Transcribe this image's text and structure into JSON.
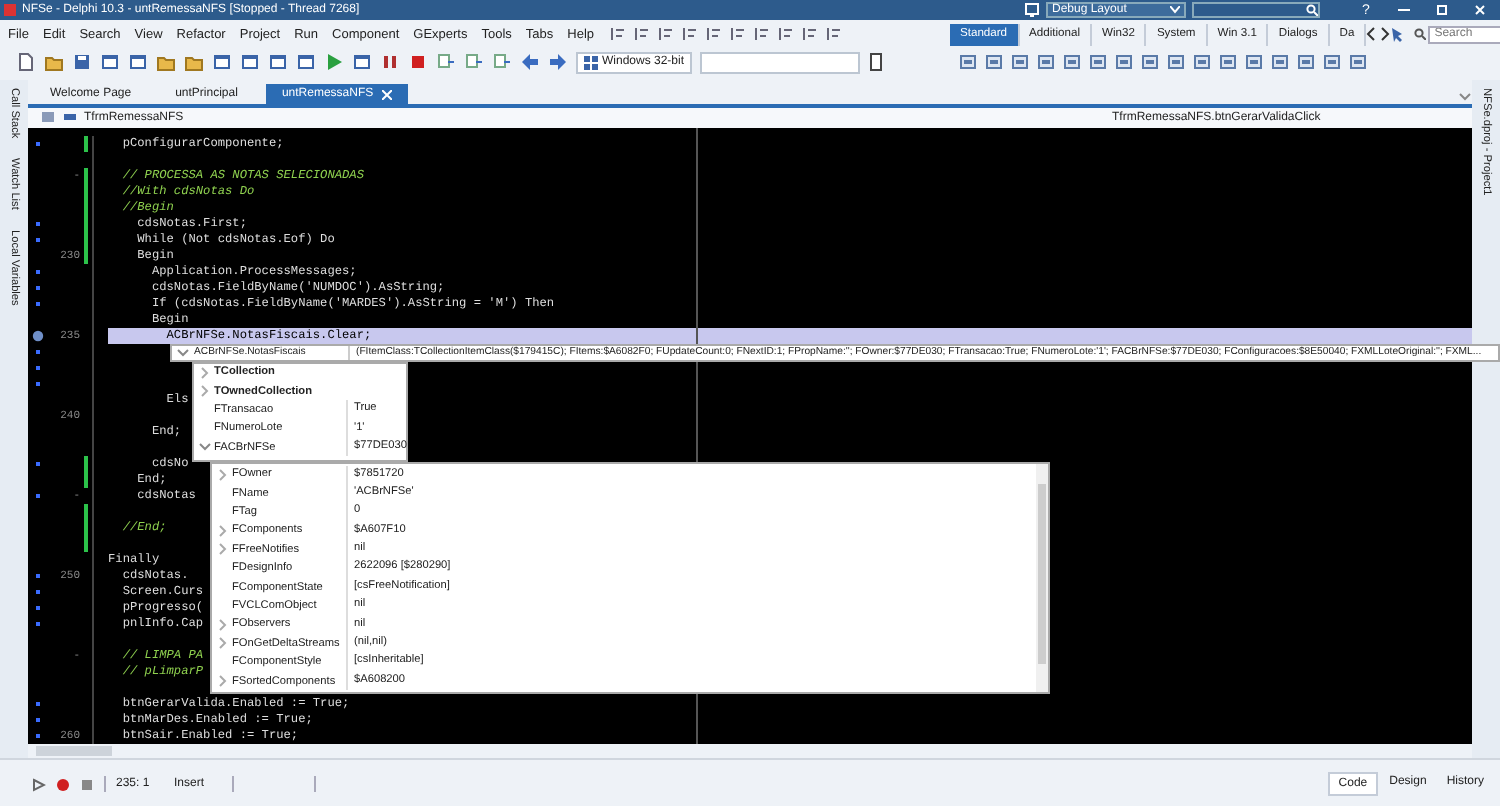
{
  "window": {
    "title": "NFSe - Delphi 10.3 - untRemessaNFS [Stopped - Thread 7268]",
    "layout": "Debug Layout",
    "help": "?"
  },
  "menu": [
    "File",
    "Edit",
    "Search",
    "View",
    "Refactor",
    "Project",
    "Run",
    "Component",
    "GExperts",
    "Tools",
    "Tabs",
    "Help"
  ],
  "toolbar": {
    "platform": "Windows 32-bit"
  },
  "palette": {
    "tabs": [
      {
        "label": "Standard",
        "selected": true
      },
      {
        "label": "Additional",
        "selected": false
      },
      {
        "label": "Win32",
        "selected": false
      },
      {
        "label": "System",
        "selected": false
      },
      {
        "label": "Win 3.1",
        "selected": false
      },
      {
        "label": "Dialogs",
        "selected": false
      },
      {
        "label": "Da",
        "selected": false
      }
    ],
    "search_placeholder": "Search"
  },
  "side_panels": [
    "Call Stack",
    "Watch List",
    "Local Variables"
  ],
  "right_panel": "NFSe.dproj - Project1",
  "editor_tabs": [
    {
      "label": "Welcome Page",
      "selected": false
    },
    {
      "label": "untPrincipal",
      "selected": false
    },
    {
      "label": "untRemessaNFS",
      "selected": true
    }
  ],
  "class_selector": "TfrmRemessaNFS",
  "method_selector": "TfrmRemessaNFS.btnGerarValidaClick",
  "lines": [
    {
      "dot": true,
      "changed": true,
      "current": false,
      "kind": "code",
      "text": "  pConfigurarComponente;"
    },
    {
      "dot": false,
      "changed": false,
      "current": false
    },
    {
      "number": "-",
      "dot": false,
      "changed": true,
      "current": false,
      "kind": "comment",
      "text": "  // PROCESSA AS NOTAS SELECIONADAS"
    },
    {
      "dot": false,
      "changed": true,
      "current": false,
      "kind": "comment",
      "text": "  //With cdsNotas Do"
    },
    {
      "dot": false,
      "changed": true,
      "current": false,
      "kind": "comment",
      "text": "  //Begin"
    },
    {
      "dot": true,
      "changed": true,
      "current": false,
      "kind": "code",
      "text": "    cdsNotas.First;"
    },
    {
      "dot": true,
      "changed": true,
      "current": false,
      "kind": "code",
      "text": "    While (Not cdsNotas.Eof) Do"
    },
    {
      "number": "230",
      "dot": false,
      "changed": true,
      "current": false,
      "kind": "code",
      "text": "    Begin"
    },
    {
      "dot": true,
      "changed": false,
      "current": false,
      "kind": "code",
      "text": "      Application.ProcessMessages;"
    },
    {
      "dot": true,
      "changed": false,
      "current": false,
      "kind": "code",
      "text": "      cdsNotas.FieldByName('NUMDOC').AsString;"
    },
    {
      "dot": true,
      "changed": false,
      "current": false,
      "kind": "code",
      "text": "      If (cdsNotas.FieldByName('MARDES').AsString = 'M') Then"
    },
    {
      "dot": false,
      "changed": false,
      "current": false,
      "kind": "code",
      "text": "      Begin"
    },
    {
      "number": "235",
      "dot": false,
      "changed": false,
      "current": true,
      "kind": "code",
      "text": "        ACBrNFSe.NotasFiscais.Clear;"
    },
    {
      "dot": true,
      "changed": false,
      "current": false
    },
    {
      "dot": true,
      "changed": false,
      "current": false
    },
    {
      "dot": true,
      "changed": false,
      "current": false
    },
    {
      "dot": false,
      "changed": false,
      "current": false,
      "kind": "code",
      "text": "        Els"
    },
    {
      "number": "240",
      "dot": false,
      "changed": false,
      "current": false
    },
    {
      "dot": false,
      "changed": false,
      "current": false,
      "kind": "code",
      "text": "      End;"
    },
    {
      "dot": false,
      "changed": false,
      "current": false
    },
    {
      "dot": true,
      "changed": true,
      "current": false,
      "kind": "code",
      "text": "      cdsNo"
    },
    {
      "dot": false,
      "changed": true,
      "current": false,
      "kind": "code",
      "text": "    End;"
    },
    {
      "number": "-",
      "dot": true,
      "changed": false,
      "current": false,
      "kind": "code",
      "text": "    cdsNotas"
    },
    {
      "dot": false,
      "changed": true,
      "current": false
    },
    {
      "dot": false,
      "changed": true,
      "current": false,
      "kind": "comment",
      "text": "  //End;"
    },
    {
      "dot": false,
      "changed": true,
      "current": false
    },
    {
      "dot": false,
      "changed": false,
      "current": false,
      "kind": "code",
      "text": "Finally"
    },
    {
      "number": "250",
      "dot": true,
      "changed": false,
      "current": false,
      "kind": "code",
      "text": "  cdsNotas."
    },
    {
      "dot": true,
      "changed": false,
      "current": false,
      "kind": "code",
      "text": "  Screen.Curs"
    },
    {
      "dot": true,
      "changed": false,
      "current": false,
      "kind": "code",
      "text": "  pProgresso("
    },
    {
      "dot": true,
      "changed": false,
      "current": false,
      "kind": "code",
      "text": "  pnlInfo.Cap"
    },
    {
      "dot": false,
      "changed": false,
      "current": false
    },
    {
      "number": "-",
      "dot": false,
      "changed": false,
      "current": false,
      "kind": "comment",
      "text": "  // LIMPA PA"
    },
    {
      "dot": false,
      "changed": false,
      "current": false,
      "kind": "comment",
      "text": "  // pLimparP"
    },
    {
      "dot": false,
      "changed": false,
      "current": false
    },
    {
      "dot": true,
      "changed": false,
      "current": false,
      "kind": "code",
      "text": "  btnGerarValida.Enabled := True;"
    },
    {
      "dot": true,
      "changed": false,
      "current": false,
      "kind": "code",
      "text": "  btnMarDes.Enabled := True;"
    },
    {
      "number": "260",
      "dot": true,
      "changed": false,
      "current": false,
      "kind": "code",
      "text": "  btnSair.Enabled := True;"
    }
  ],
  "inspector": {
    "expression": "ACBrNFSe.NotasFiscais",
    "summary": "(FItemClass:TCollectionItemClass($179415C); FItems:$A6082F0; FUpdateCount:0; FNextID:1; FPropName:''; FOwner:$77DE030; FTransacao:True; FNumeroLote:'1'; FACBrNFSe:$77DE030; FConfiguracoes:$8E50040; FXMLLoteOriginal:''; FXML...",
    "members": [
      {
        "kind": "class",
        "name": "TCollection",
        "expandable": true,
        "expanded": false
      },
      {
        "kind": "class",
        "name": "TOwnedCollection",
        "expandable": true,
        "expanded": false
      },
      {
        "kind": "field",
        "name": "FTransacao",
        "value": "True",
        "expandable": false,
        "expanded": false
      },
      {
        "kind": "field",
        "name": "FNumeroLote",
        "value": "'1'",
        "expandable": false,
        "expanded": false
      },
      {
        "kind": "field",
        "name": "FACBrNFSe",
        "value": "$77DE030",
        "expandable": true,
        "expanded": true,
        "children": [
          {
            "kind": "field",
            "name": "FOwner",
            "value": "$7851720",
            "expandable": true,
            "expanded": false
          },
          {
            "kind": "field",
            "name": "FName",
            "value": "'ACBrNFSe'",
            "expandable": false,
            "expanded": false
          },
          {
            "kind": "field",
            "name": "FTag",
            "value": "0",
            "expandable": false,
            "expanded": false
          },
          {
            "kind": "field",
            "name": "FComponents",
            "value": "$A607F10",
            "expandable": true,
            "expanded": false
          },
          {
            "kind": "field",
            "name": "FFreeNotifies",
            "value": "nil",
            "expandable": true,
            "expanded": false
          },
          {
            "kind": "field",
            "name": "FDesignInfo",
            "value": "2622096 [$280290]",
            "expandable": false,
            "expanded": false
          },
          {
            "kind": "field",
            "name": "FComponentState",
            "value": "[csFreeNotification]",
            "expandable": false,
            "expanded": false
          },
          {
            "kind": "field",
            "name": "FVCLComObject",
            "value": "nil",
            "expandable": false,
            "expanded": false
          },
          {
            "kind": "field",
            "name": "FObservers",
            "value": "nil",
            "expandable": true,
            "expanded": false
          },
          {
            "kind": "field",
            "name": "FOnGetDeltaStreams",
            "value": "(nil,nil)",
            "expandable": true,
            "expanded": false
          },
          {
            "kind": "field",
            "name": "FComponentStyle",
            "value": "[csInheritable]",
            "expandable": false,
            "expanded": false
          },
          {
            "kind": "field",
            "name": "FSortedComponents",
            "value": "$A608200",
            "expandable": true,
            "expanded": false
          }
        ]
      }
    ]
  },
  "status": {
    "position": "235: 1",
    "mode": "Insert"
  },
  "view_tabs": [
    {
      "label": "Code",
      "selected": true
    },
    {
      "label": "Design",
      "selected": false
    },
    {
      "label": "History",
      "selected": false
    }
  ]
}
